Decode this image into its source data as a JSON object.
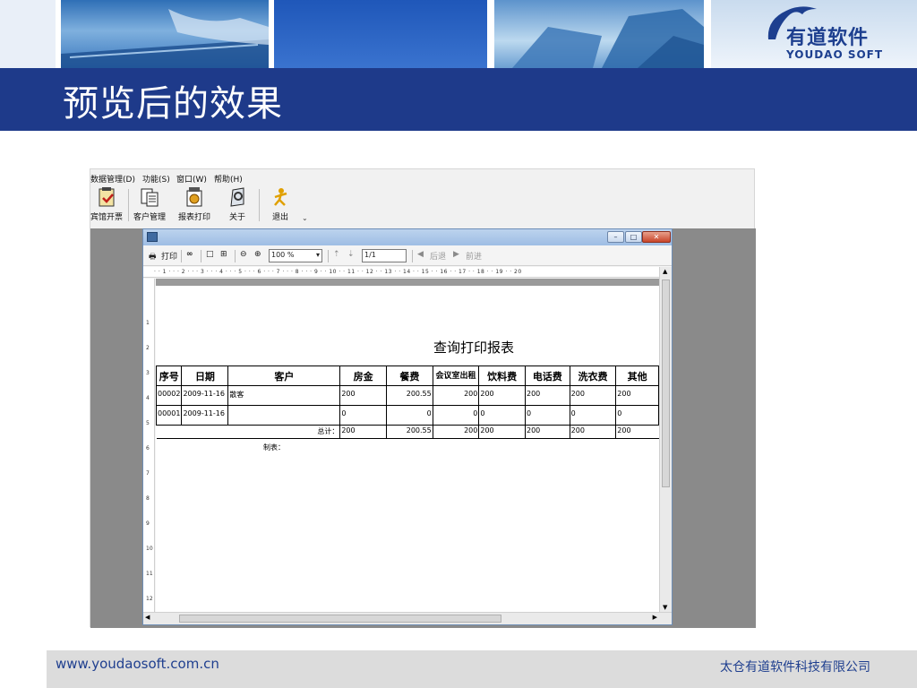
{
  "slide": {
    "title": "预览后的效果",
    "logo_cn": "有道软件",
    "logo_en": "YOUDAO SOFT",
    "footer_url": "www.youdaosoft.com.cn",
    "footer_company": "太仓有道软件科技有限公司",
    "accent_color": "#1e3a8a"
  },
  "app": {
    "menu": [
      {
        "label": "数据管理(D)",
        "shortcut": "D"
      },
      {
        "label": "功能(S)",
        "shortcut": "S"
      },
      {
        "label": "窗口(W)",
        "shortcut": "W"
      },
      {
        "label": "帮助(H)",
        "shortcut": "H"
      }
    ],
    "toolbar": [
      {
        "label": "宾馆开票",
        "icon": "invoice-icon"
      },
      {
        "label": "客户管理",
        "icon": "customer-icon"
      },
      {
        "label": "报表打印",
        "icon": "report-print-icon"
      },
      {
        "label": "关于",
        "icon": "about-icon"
      },
      {
        "label": "退出",
        "icon": "exit-icon"
      }
    ]
  },
  "preview": {
    "print_label": "打印",
    "zoom_value": "100 %",
    "page_value": "1/1",
    "back_label": "后退",
    "forward_label": "前进",
    "hruler_text": "· · 1 · · · 2 · · · 3 · · · 4 · · · 5 · · · 6 · · · 7 · · · 8 · · · 9 · · 10 · · 11 · · 12 · · 13 · · 14 · · 15 · · 16 · · 17 · · 18 · · 19 · · 20",
    "vruler_marks": [
      "1",
      "2",
      "3",
      "4",
      "5",
      "6",
      "7",
      "8",
      "9",
      "10",
      "11",
      "12"
    ],
    "window_buttons": {
      "minimize": "–",
      "maximize": "□",
      "close": "✕"
    }
  },
  "report": {
    "title": "查询打印报表",
    "columns": [
      "序号",
      "日期",
      "客户",
      "房金",
      "餐费",
      "会议室出租",
      "饮料费",
      "电话费",
      "洗衣费",
      "其他"
    ],
    "rows": [
      [
        "00002",
        "2009-11-16",
        "散客",
        "200",
        "200.55",
        "200",
        "200",
        "200",
        "200",
        "200"
      ],
      [
        "00001",
        "2009-11-16",
        "",
        "0",
        "0",
        "0",
        "0",
        "0",
        "0",
        "0"
      ]
    ],
    "total_label": "总计：",
    "totals": [
      "200",
      "200.55",
      "200",
      "200",
      "200",
      "200",
      "200"
    ],
    "maker_label": "制表："
  }
}
